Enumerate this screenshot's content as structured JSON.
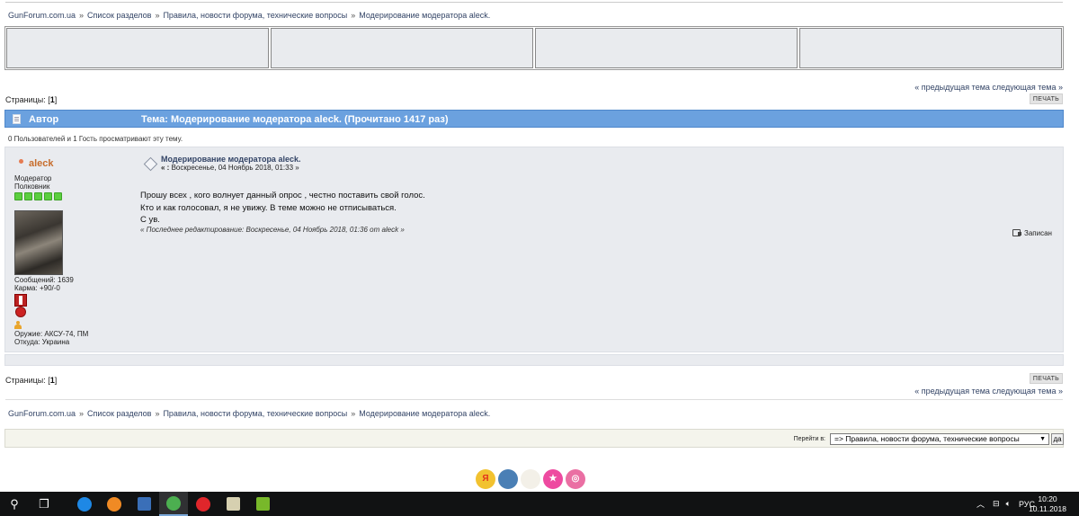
{
  "breadcrumb": {
    "items": [
      "GunForum.com.ua",
      "Список разделов",
      "Правила, новости форума, технические вопросы",
      "Модерирование модератора aleck."
    ],
    "separator": "»"
  },
  "nav": {
    "prev": "« предыдущая тема",
    "next": "следующая тема »"
  },
  "pages": {
    "label": "Страницы:",
    "current": "1"
  },
  "print_label": "ПЕЧАТЬ",
  "titlebar": {
    "author_label": "Автор",
    "topic": "Тема: Модерирование модератора aleck.  (Прочитано 1417 раз)"
  },
  "viewers_text": "0 Пользователей и 1 Гость просматривают эту тему.",
  "post": {
    "author": {
      "name": "aleck",
      "role": "Модератор",
      "rank": "Полковник",
      "stars": 5,
      "posts": "Сообщений: 1639",
      "karma": "Карма: +90/-0",
      "weapon": "Оружие: АКСУ-74, ПМ",
      "from": "Откуда: Украина"
    },
    "subject": "Модерирование модератора aleck.",
    "date_prefix": "« :",
    "date": "Воскресенье, 04 Ноябрь 2018, 01:33 »",
    "body": [
      "Прошу всех , кого волнует данный опрос , честно поставить свой голос.",
      "Кто и как голосовал, я не увижу. В теме можно не отписываться.",
      "С ув."
    ],
    "edited": "« Последнее редактирование: Воскресенье, 04 Ноябрь 2018, 01:36 от aleck »",
    "recorded_label": "Записан"
  },
  "jump": {
    "label": "Перейти в:",
    "selected": "=> Правила, новости форума, технические вопросы",
    "go": "да"
  },
  "social_icons": [
    {
      "name": "yandex-icon",
      "glyph": "Я",
      "color": "#f2c230",
      "text_color": "#e2321d"
    },
    {
      "name": "livejournal-icon",
      "glyph": "",
      "color": "#4a7fb5",
      "text_color": "#ffffff"
    },
    {
      "name": "mail-agent-icon",
      "glyph": "",
      "color": "#f3f0e8",
      "text_color": "#ffffff"
    },
    {
      "name": "star-icon",
      "glyph": "★",
      "color": "#ee4aa0",
      "text_color": "#ffffff"
    },
    {
      "name": "dribbble-icon",
      "glyph": "◎",
      "color": "#ea6fa3",
      "text_color": "#ffffff"
    }
  ],
  "taskbar": {
    "apps": [
      {
        "name": "search-icon",
        "glyph": "⚲",
        "color": ""
      },
      {
        "name": "task-view-icon",
        "glyph": "❐",
        "color": ""
      },
      {
        "name": "teamviewer-icon",
        "glyph": "",
        "color": "#1e88e5"
      },
      {
        "name": "firefox-icon",
        "glyph": "",
        "color": "#f08a24"
      },
      {
        "name": "save-floppy-icon",
        "glyph": "",
        "color": "#3a6fb8"
      },
      {
        "name": "chrome-icon",
        "glyph": "",
        "color": "#4caf50"
      },
      {
        "name": "opera-icon",
        "glyph": "",
        "color": "#e0262b"
      },
      {
        "name": "globe-app-icon",
        "glyph": "",
        "color": "#d6d0b0"
      },
      {
        "name": "utorrent-icon",
        "glyph": "",
        "color": "#78b82a"
      }
    ],
    "tray": {
      "language": "РУС",
      "time": "10:20",
      "date": "10.11.2018"
    }
  }
}
